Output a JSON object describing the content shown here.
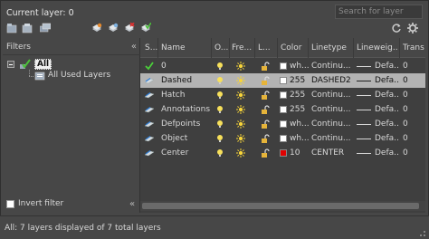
{
  "header": {
    "title": "Current layer: 0",
    "search_placeholder": "Search for layer"
  },
  "toolbar": {
    "icons": [
      "new-property-filter-icon",
      "new-group-filter-icon",
      "layer-states-manager-icon",
      "new-layer-icon",
      "new-layer-vp-frozen-icon",
      "delete-layer-icon",
      "set-current-icon",
      "refresh-icon",
      "settings-icon"
    ]
  },
  "filters": {
    "header": "Filters",
    "collapse_glyph": "«",
    "tree": {
      "root_label": "All",
      "child_label": "All Used Layers"
    },
    "invert_label": "Invert filter",
    "invert_checked": false
  },
  "columns": {
    "status": "S...",
    "name": "Name",
    "on": "O...",
    "freeze": "Fre...",
    "lock": "L...",
    "color": "Color",
    "linetype": "Linetype",
    "lineweight": "Lineweig...",
    "transparency": "Trans"
  },
  "layers": [
    {
      "name": "0",
      "color_label": "wh...",
      "color_hex": "#ffffff",
      "linetype": "Continu...",
      "lineweight": "Defa...",
      "transparency": "0",
      "current": true,
      "selected": false
    },
    {
      "name": "Dashed",
      "color_label": "255",
      "color_hex": "#ffffff",
      "linetype": "DASHED2",
      "lineweight": "Defa...",
      "transparency": "0",
      "current": false,
      "selected": true
    },
    {
      "name": "Hatch",
      "color_label": "255",
      "color_hex": "#ffffff",
      "linetype": "Continu...",
      "lineweight": "Defa...",
      "transparency": "0",
      "current": false,
      "selected": false
    },
    {
      "name": "Annotations",
      "color_label": "255",
      "color_hex": "#ffffff",
      "linetype": "Continu...",
      "lineweight": "Defa...",
      "transparency": "0",
      "current": false,
      "selected": false
    },
    {
      "name": "Defpoints",
      "color_label": "wh...",
      "color_hex": "#ffffff",
      "linetype": "Continu...",
      "lineweight": "Defa...",
      "transparency": "0",
      "current": false,
      "selected": false
    },
    {
      "name": "Object",
      "color_label": "wh...",
      "color_hex": "#ffffff",
      "linetype": "Continu...",
      "lineweight": "Defa...",
      "transparency": "0",
      "current": false,
      "selected": false
    },
    {
      "name": "Center",
      "color_label": "10",
      "color_hex": "#e00000",
      "linetype": "CENTER",
      "lineweight": "Defa...",
      "transparency": "0",
      "current": false,
      "selected": false
    }
  ],
  "status": {
    "text": "All: 7 layers displayed of 7 total layers"
  }
}
